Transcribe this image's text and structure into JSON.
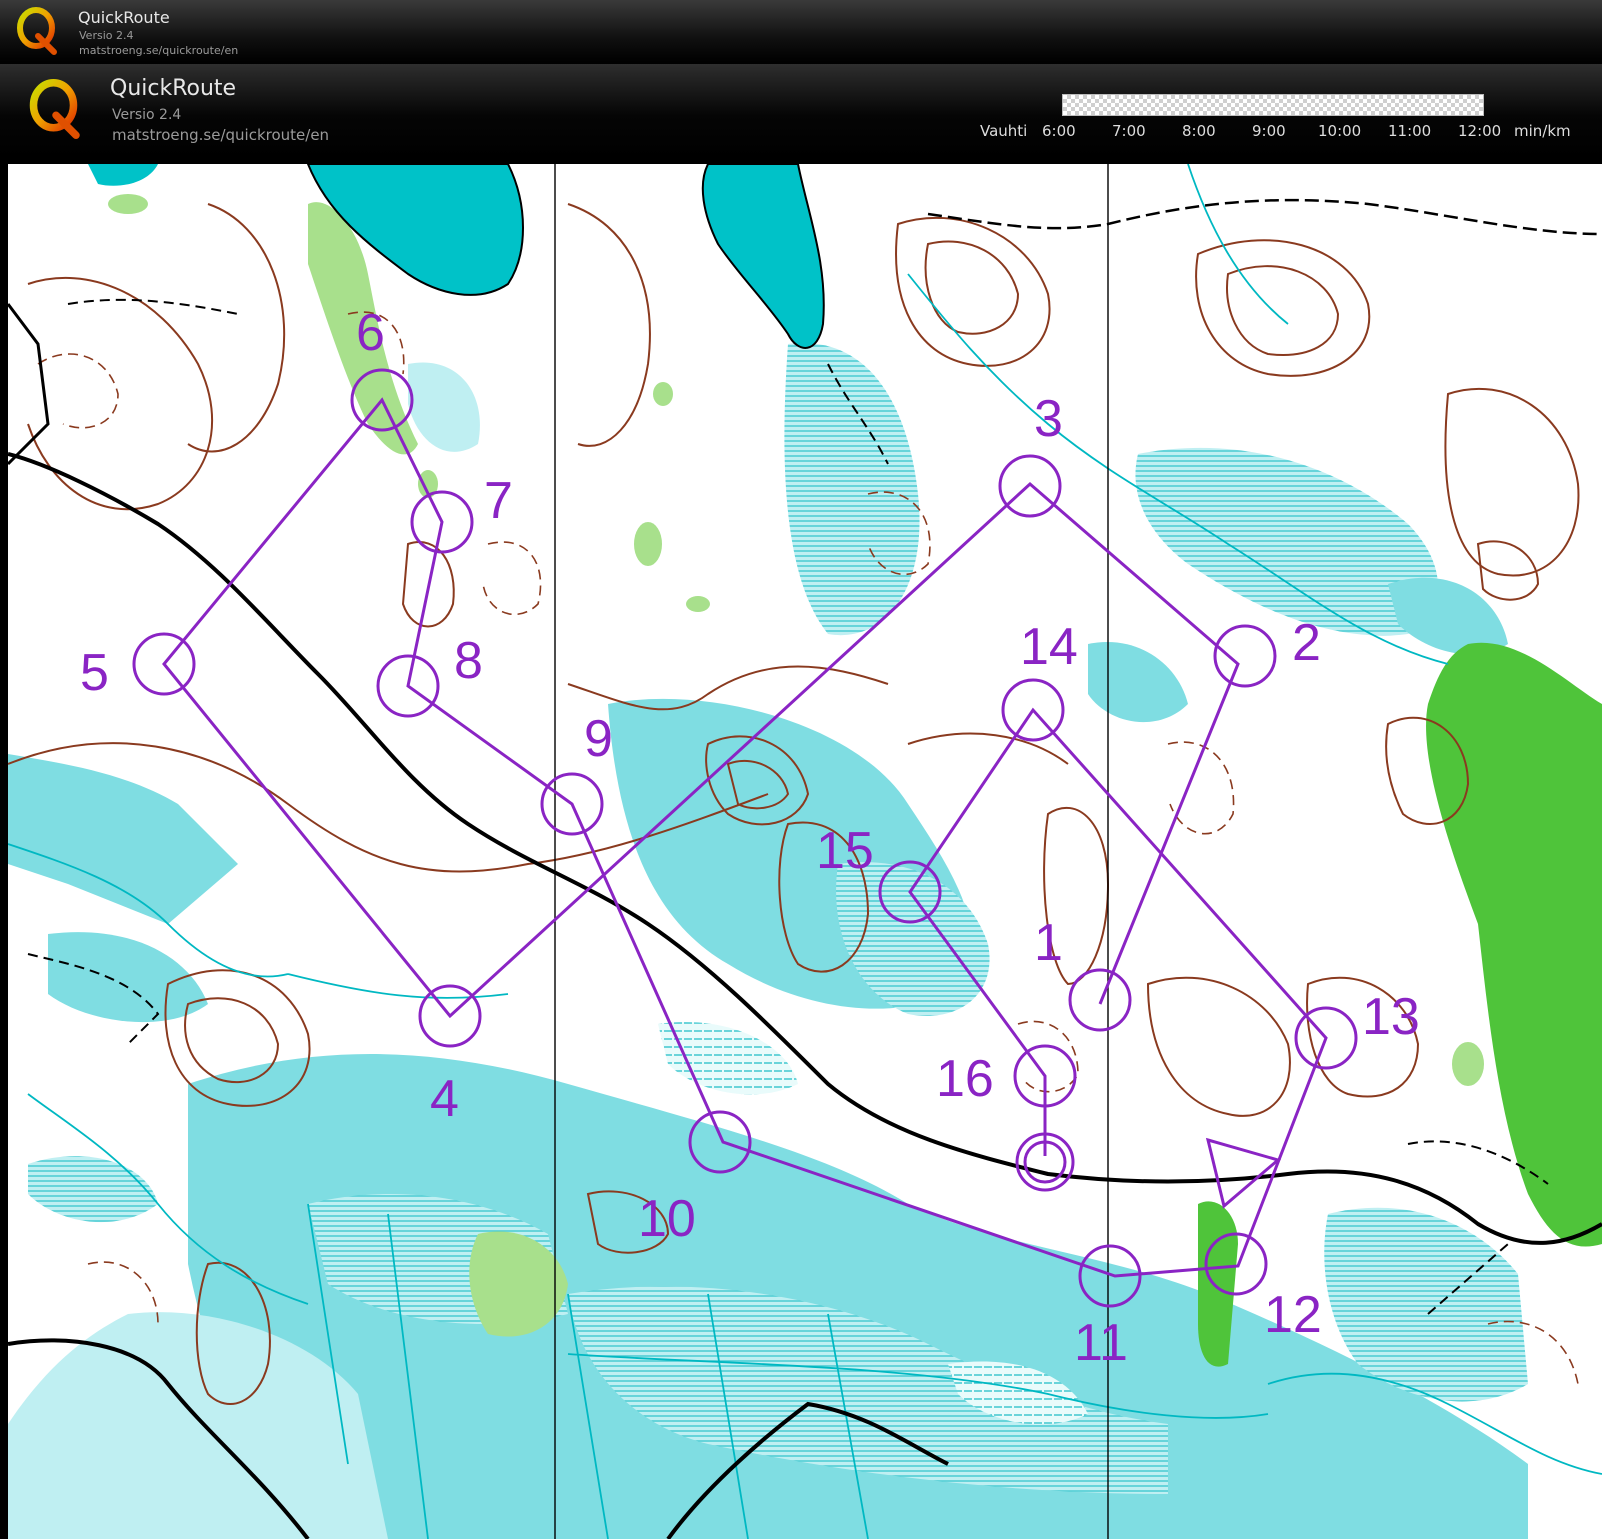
{
  "app": {
    "name": "QuickRoute",
    "version": "Versio 2.4",
    "url": "matstroeng.se/quickroute/en"
  },
  "pace_scale": {
    "label": "Vauhti",
    "ticks": [
      "6:00",
      "7:00",
      "8:00",
      "9:00",
      "10:00",
      "11:00",
      "12:00"
    ],
    "unit": "min/km"
  },
  "colors": {
    "course": "#8a24c4",
    "contour": "#8a3a1f",
    "water": "#00c2c8",
    "marsh": "#3fc8cf",
    "open_land": "#5fd0d6",
    "forest_green": "#4fc43a",
    "light_green": "#a8e08c"
  },
  "course": {
    "controls": [
      "1",
      "2",
      "3",
      "4",
      "5",
      "6",
      "7",
      "8",
      "9",
      "10",
      "11",
      "12",
      "13",
      "14",
      "15",
      "16"
    ]
  }
}
